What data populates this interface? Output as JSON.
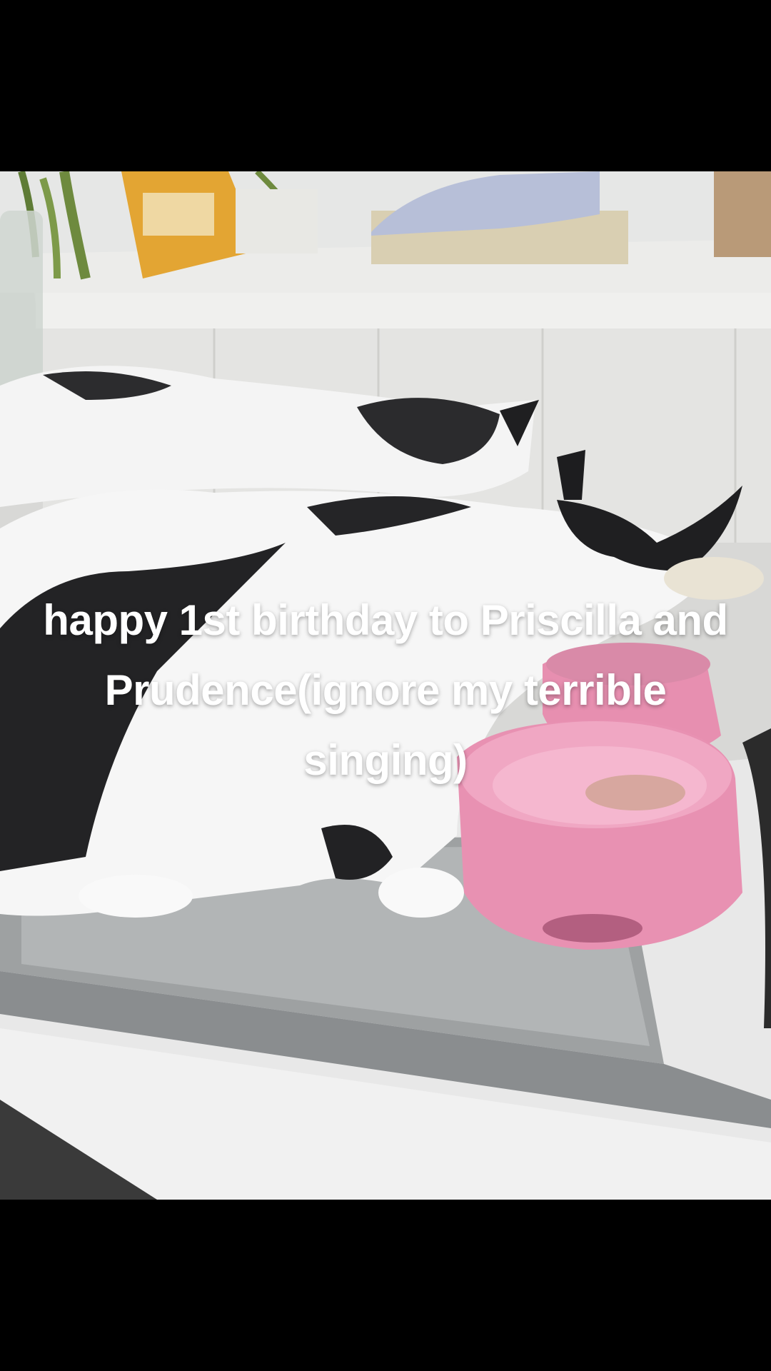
{
  "caption": {
    "text": "happy 1st birthday to Priscilla and Prudence(ignore my terrible singing)"
  },
  "colors": {
    "background": "#000000",
    "caption_text": "#ffffff"
  }
}
